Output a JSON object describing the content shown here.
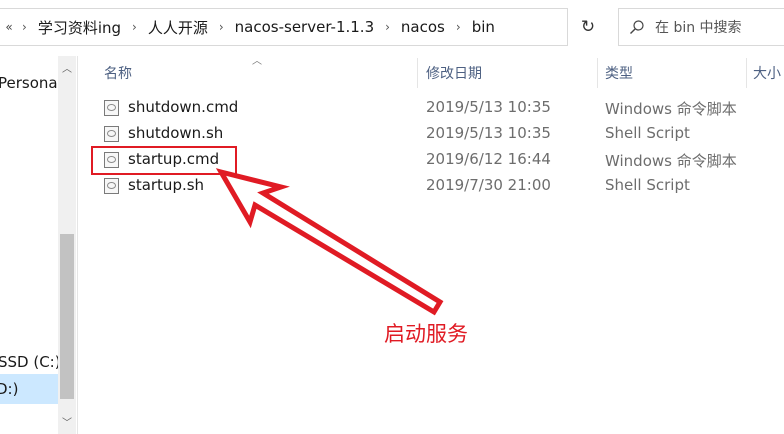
{
  "address": {
    "more": "«",
    "crumbs": [
      "学习资料ing",
      "人人开源",
      "nacos-server-1.1.3",
      "nacos",
      "bin"
    ],
    "separator": "›",
    "dropdown_glyph": "⌄",
    "refresh_glyph": "↻",
    "search_placeholder": "在 bin 中搜索"
  },
  "nav": {
    "items": [
      "Personal",
      "SSD (C:)",
      "D:)"
    ]
  },
  "columns": {
    "name": "名称",
    "modified": "修改日期",
    "type": "类型",
    "size": "大小"
  },
  "files": [
    {
      "name": "shutdown.cmd",
      "modified": "2019/5/13 10:35",
      "type": "Windows 命令脚本"
    },
    {
      "name": "shutdown.sh",
      "modified": "2019/5/13 10:35",
      "type": "Shell Script"
    },
    {
      "name": "startup.cmd",
      "modified": "2019/6/12 16:44",
      "type": "Windows 命令脚本"
    },
    {
      "name": "startup.sh",
      "modified": "2019/7/30 21:00",
      "type": "Shell Script"
    }
  ],
  "annotation": {
    "text": "启动服务",
    "color": "#e01b24"
  }
}
